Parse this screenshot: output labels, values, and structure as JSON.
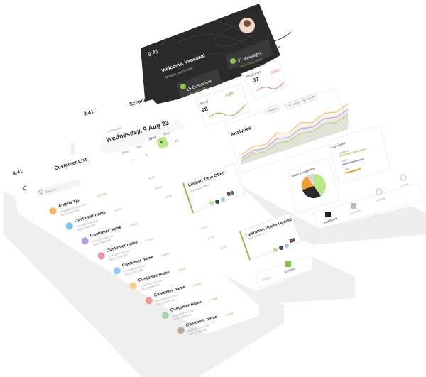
{
  "status": {
    "time": "9:41"
  },
  "dashboard": {
    "welcome": "Welcome, Vanessa!",
    "location": "Moskin, Indonesia",
    "cards": [
      {
        "label": "15 Customers",
        "sub": "see contact list"
      },
      {
        "label": "37 Messages",
        "sub": "see pending details"
      }
    ],
    "response": {
      "title": "Response",
      "value": "37",
      "badge": "+21%"
    },
    "send": {
      "title": "Send",
      "value": "98",
      "badge": "+12%"
    },
    "analytics": {
      "title": "Analytics",
      "period": "Weekly",
      "range": "01 Feb 23 - 30 Feb 23"
    },
    "pie": {
      "title": "Deals & Acquisition"
    },
    "top_list": {
      "title": "Top Fashion",
      "items": [
        "Marketing",
        "Sales",
        "Ads"
      ]
    },
    "nav": [
      "Dashboard",
      "Schedule",
      "Activity",
      "Profile"
    ]
  },
  "chart_data": [
    {
      "type": "area",
      "title": "Analytics",
      "series": [
        {
          "name": "",
          "color": "#f1c27a",
          "values": [
            30,
            45,
            38,
            62,
            50,
            70,
            58,
            75,
            66,
            80
          ]
        },
        {
          "name": "",
          "color": "#b9a7e8",
          "values": [
            20,
            32,
            26,
            45,
            36,
            52,
            44,
            58,
            50,
            62
          ]
        },
        {
          "name": "",
          "color": "#a9d98a",
          "values": [
            12,
            22,
            16,
            30,
            24,
            36,
            30,
            42,
            34,
            46
          ]
        }
      ]
    },
    {
      "type": "pie",
      "title": "Deals & Acquisition",
      "values": [
        40,
        30,
        20,
        10
      ],
      "colors": [
        "#b8e986",
        "#2b2b2b",
        "#f59e2b",
        "#d9d9d9"
      ]
    }
  ],
  "schedule": {
    "time": "9:41",
    "title": "Schedule",
    "messages": "3 messages",
    "date": "Wednesday, 9 Aug 23",
    "days": [
      "Mon",
      "Tue",
      "Wed",
      "Thu"
    ],
    "day_nums": [
      "7",
      "8",
      "9",
      "10"
    ],
    "times": [
      "08:00",
      "09:00",
      "10:00",
      "11:00",
      "12:00",
      "13:00"
    ],
    "events": [
      {
        "title": "Limited Time Offer",
        "sub": "Exclusive offers",
        "count": "+72"
      },
      {
        "title": "Operation Hours Update",
        "sub": "New schedule",
        "count": "+2"
      }
    ],
    "nav": [
      "Contact",
      "Schedule",
      "Activity"
    ]
  },
  "customers": {
    "time": "9:41",
    "title": "Customer List",
    "search": "Search",
    "list": [
      {
        "name": "Angela Tjo",
        "tag": "2 weeks",
        "email": "angelatjo@email.com",
        "phone": "082123456789",
        "av": "#f5b56b"
      },
      {
        "name": "Customer name",
        "tag": "1 week",
        "email": "email@email.com",
        "phone": "082123456789",
        "av": "#7cc4f2"
      },
      {
        "name": "Customer name",
        "tag": "1 week",
        "email": "email@email.com",
        "phone": "082123456789",
        "av": "#b39ddb"
      },
      {
        "name": "Customer name",
        "tag": "1 week",
        "email": "email@email.com",
        "phone": "082123456789",
        "av": "#f48fb1"
      },
      {
        "name": "Customer name",
        "tag": "1 week",
        "email": "email@email.com",
        "phone": "082123456789",
        "av": "#90caf9"
      },
      {
        "name": "Customer name",
        "tag": "1 week",
        "email": "email@email.com",
        "phone": "082123456789",
        "av": "#ffcc80"
      },
      {
        "name": "Customer name",
        "tag": "1 week",
        "email": "email@email.com",
        "phone": "082123456789",
        "av": "#ef9a9a"
      },
      {
        "name": "Customer name",
        "tag": "1 week",
        "email": "email@email.com",
        "phone": "082123456789",
        "av": "#a5d6a7"
      },
      {
        "name": "Customer name",
        "tag": "1 week",
        "email": "email@email.com",
        "phone": "082123456789",
        "av": "#bcaaa4"
      }
    ]
  }
}
